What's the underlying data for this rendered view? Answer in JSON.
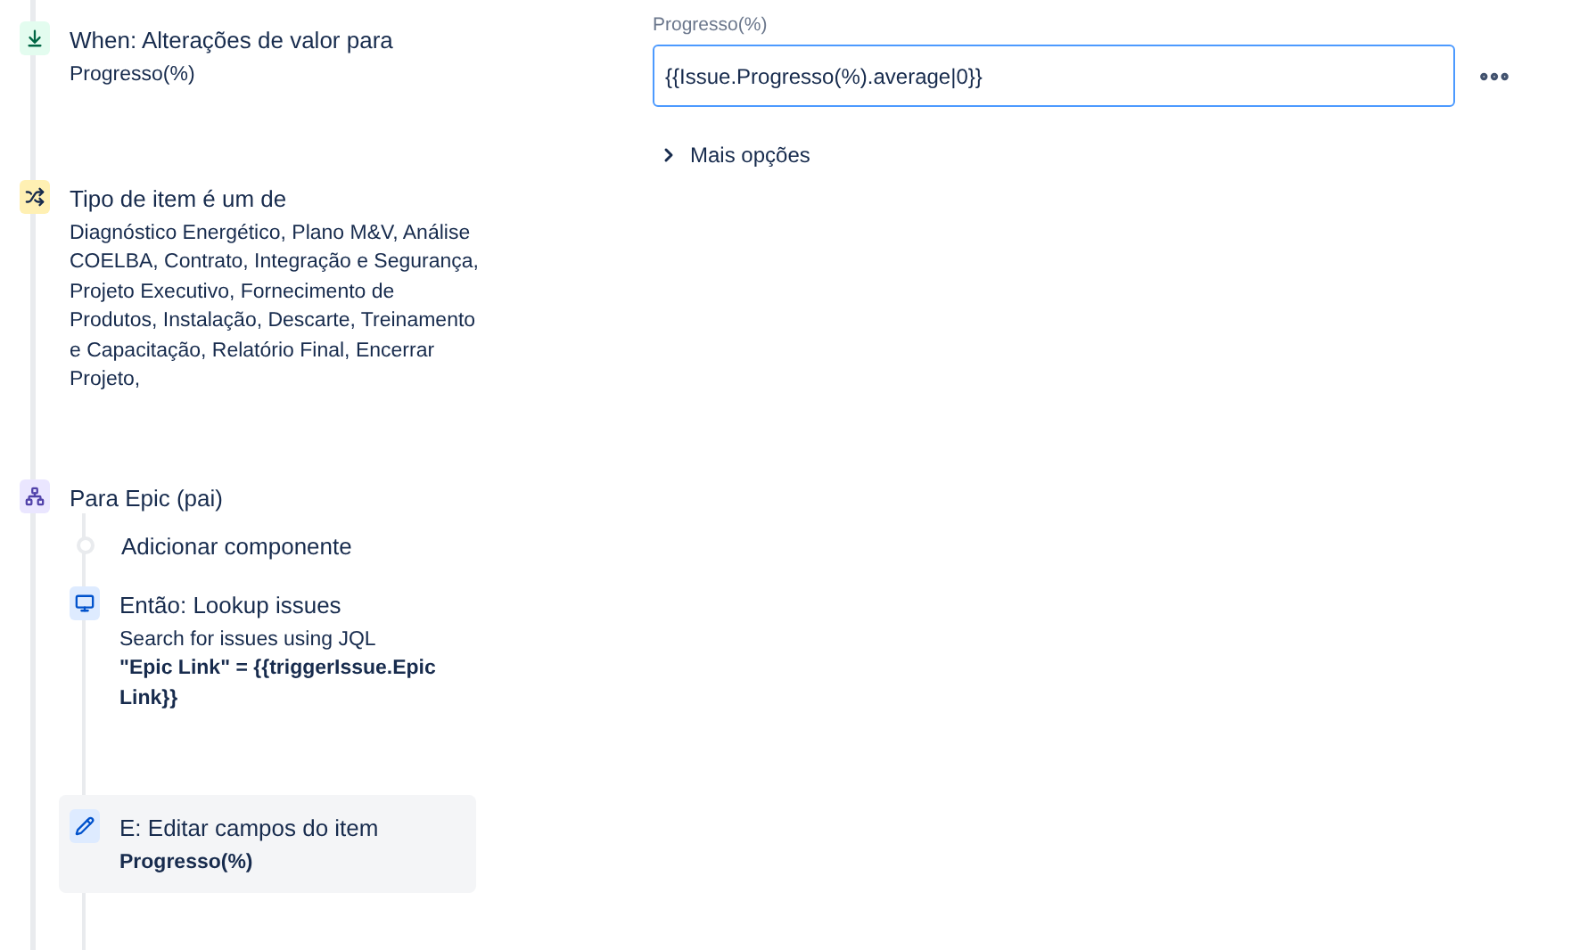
{
  "steps": [
    {
      "kind": "trigger",
      "title": "When: Alterações de valor para",
      "detail": "Progresso(%)"
    },
    {
      "kind": "condition",
      "title": "Tipo de item é um de",
      "detail": "Diagnóstico Energético, Plano M&V, Análise COELBA, Contrato, Integração e Segurança, Projeto Executivo, Fornecimento de Produtos, Instalação, Descarte, Treinamento e Capacitação, Relatório Final, Encerrar Projeto,"
    },
    {
      "kind": "branch",
      "title": "Para Epic (pai)",
      "children": [
        {
          "kind": "add",
          "title": "Adicionar componente"
        },
        {
          "kind": "lookup",
          "title": "Então: Lookup issues",
          "detail": "Search for issues using JQL",
          "detail_bold": "\"Epic Link\" = {{triggerIssue.Epic Link}}",
          "selected": false
        },
        {
          "kind": "edit",
          "title": "E: Editar campos do item",
          "detail_bold": "Progresso(%)",
          "selected": true
        }
      ]
    }
  ],
  "editor": {
    "field_label": "Progresso(%)",
    "value": "{{Issue.Progresso(%).average|0}}",
    "more_options": "Mais opções"
  }
}
